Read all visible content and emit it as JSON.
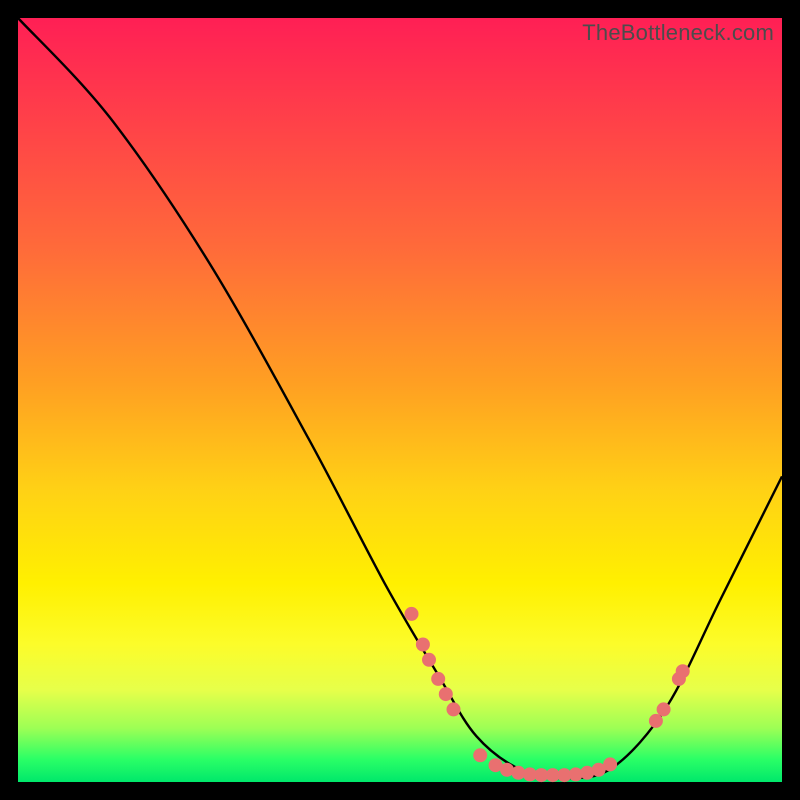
{
  "watermark": "TheBottleneck.com",
  "chart_data": {
    "type": "line",
    "title": "",
    "xlabel": "",
    "ylabel": "",
    "xlim": [
      0,
      100
    ],
    "ylim": [
      0,
      100
    ],
    "grid": false,
    "curve_percent": [
      {
        "x": 0,
        "y": 100
      },
      {
        "x": 12,
        "y": 87
      },
      {
        "x": 25,
        "y": 68
      },
      {
        "x": 38,
        "y": 45
      },
      {
        "x": 48,
        "y": 26
      },
      {
        "x": 55,
        "y": 14
      },
      {
        "x": 60,
        "y": 6
      },
      {
        "x": 66,
        "y": 1.5
      },
      {
        "x": 72,
        "y": 0.5
      },
      {
        "x": 78,
        "y": 2
      },
      {
        "x": 85,
        "y": 10
      },
      {
        "x": 92,
        "y": 24
      },
      {
        "x": 100,
        "y": 40
      }
    ],
    "markers_percent": [
      {
        "x": 51.5,
        "y": 22.0
      },
      {
        "x": 53.0,
        "y": 18.0
      },
      {
        "x": 53.8,
        "y": 16.0
      },
      {
        "x": 55.0,
        "y": 13.5
      },
      {
        "x": 56.0,
        "y": 11.5
      },
      {
        "x": 57.0,
        "y": 9.5
      },
      {
        "x": 60.5,
        "y": 3.5
      },
      {
        "x": 62.5,
        "y": 2.2
      },
      {
        "x": 64.0,
        "y": 1.6
      },
      {
        "x": 65.5,
        "y": 1.2
      },
      {
        "x": 67.0,
        "y": 1.0
      },
      {
        "x": 68.5,
        "y": 0.9
      },
      {
        "x": 70.0,
        "y": 0.9
      },
      {
        "x": 71.5,
        "y": 0.9
      },
      {
        "x": 73.0,
        "y": 1.0
      },
      {
        "x": 74.5,
        "y": 1.2
      },
      {
        "x": 76.0,
        "y": 1.6
      },
      {
        "x": 77.5,
        "y": 2.3
      },
      {
        "x": 83.5,
        "y": 8.0
      },
      {
        "x": 84.5,
        "y": 9.5
      },
      {
        "x": 86.5,
        "y": 13.5
      },
      {
        "x": 87.0,
        "y": 14.5
      }
    ],
    "marker_color": "#e97070",
    "curve_color": "#000000"
  }
}
